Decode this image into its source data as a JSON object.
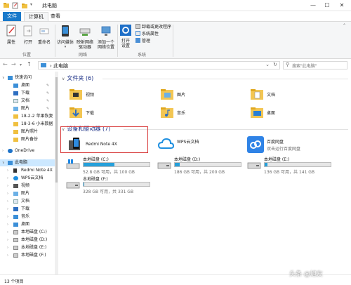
{
  "window": {
    "title": "此电脑",
    "minimize": "—",
    "maximize": "☐",
    "close": "✕"
  },
  "tabs": {
    "file": "文件",
    "computer": "计算机",
    "view": "查看"
  },
  "ribbon": {
    "location": {
      "properties": "属性",
      "open": "打开",
      "rename": "重命名",
      "group": "位置"
    },
    "network": {
      "access_media": "访问媒体",
      "map_drive_1": "映射网络",
      "map_drive_2": "驱动器",
      "add_location_1": "添加一个",
      "add_location_2": "网络位置",
      "group": "网络"
    },
    "system": {
      "open_settings_1": "打开",
      "open_settings_2": "设置",
      "uninstall": "卸载或更改程序",
      "system_props": "系统属性",
      "manage": "管理",
      "group": "系统"
    }
  },
  "address": {
    "path": "此电脑",
    "search_placeholder": "搜索\"此电脑\""
  },
  "nav": {
    "items": [
      {
        "label": "快速访问"
      },
      {
        "label": "桌面"
      },
      {
        "label": "下载"
      },
      {
        "label": "文档"
      },
      {
        "label": "图片"
      },
      {
        "label": "18-2-2 苹果恢复"
      },
      {
        "label": "18-3-6 小米数据"
      },
      {
        "label": "图片照片"
      },
      {
        "label": "图片备份"
      },
      {
        "label": "OneDrive"
      },
      {
        "label": "此电脑"
      },
      {
        "label": "Redmi Note 4X"
      },
      {
        "label": "WPS云文档"
      },
      {
        "label": "视频"
      },
      {
        "label": "图片"
      },
      {
        "label": "文档"
      },
      {
        "label": "下载"
      },
      {
        "label": "音乐"
      },
      {
        "label": "桌面"
      },
      {
        "label": "本地磁盘 (C:)"
      },
      {
        "label": "本地磁盘 (D:)"
      },
      {
        "label": "本地磁盘 (E:)"
      },
      {
        "label": "本地磁盘 (F:)"
      }
    ]
  },
  "content": {
    "folders_header": "文件夹",
    "folders_count": "(6)",
    "folders": [
      {
        "label": "视频"
      },
      {
        "label": "图片"
      },
      {
        "label": "文档"
      },
      {
        "label": "下载"
      },
      {
        "label": "音乐"
      },
      {
        "label": "桌面"
      }
    ],
    "devices_header": "设备和驱动器",
    "devices_count": "(7)",
    "phone": {
      "name": "Redmi Note 4X"
    },
    "wps": {
      "name": "WPS云文档"
    },
    "baidu": {
      "name": "百度网盘",
      "sub": "双击运行百度网盘"
    },
    "drives": [
      {
        "name": "本地磁盘 (C:)",
        "free": "52.8 GB 可用，共 100 GB",
        "used_fraction": 0.47
      },
      {
        "name": "本地磁盘 (D:)",
        "free": "186 GB 可用，共 200 GB",
        "used_fraction": 0.07
      },
      {
        "name": "本地磁盘 (E:)",
        "free": "136 GB 可用，共 141 GB",
        "used_fraction": 0.04
      },
      {
        "name": "本地磁盘 (F:)",
        "free": "328 GB 可用，共 331 GB",
        "used_fraction": 0.01
      }
    ]
  },
  "status": {
    "count": "13 个项目"
  },
  "watermark": "头条 @旭友"
}
